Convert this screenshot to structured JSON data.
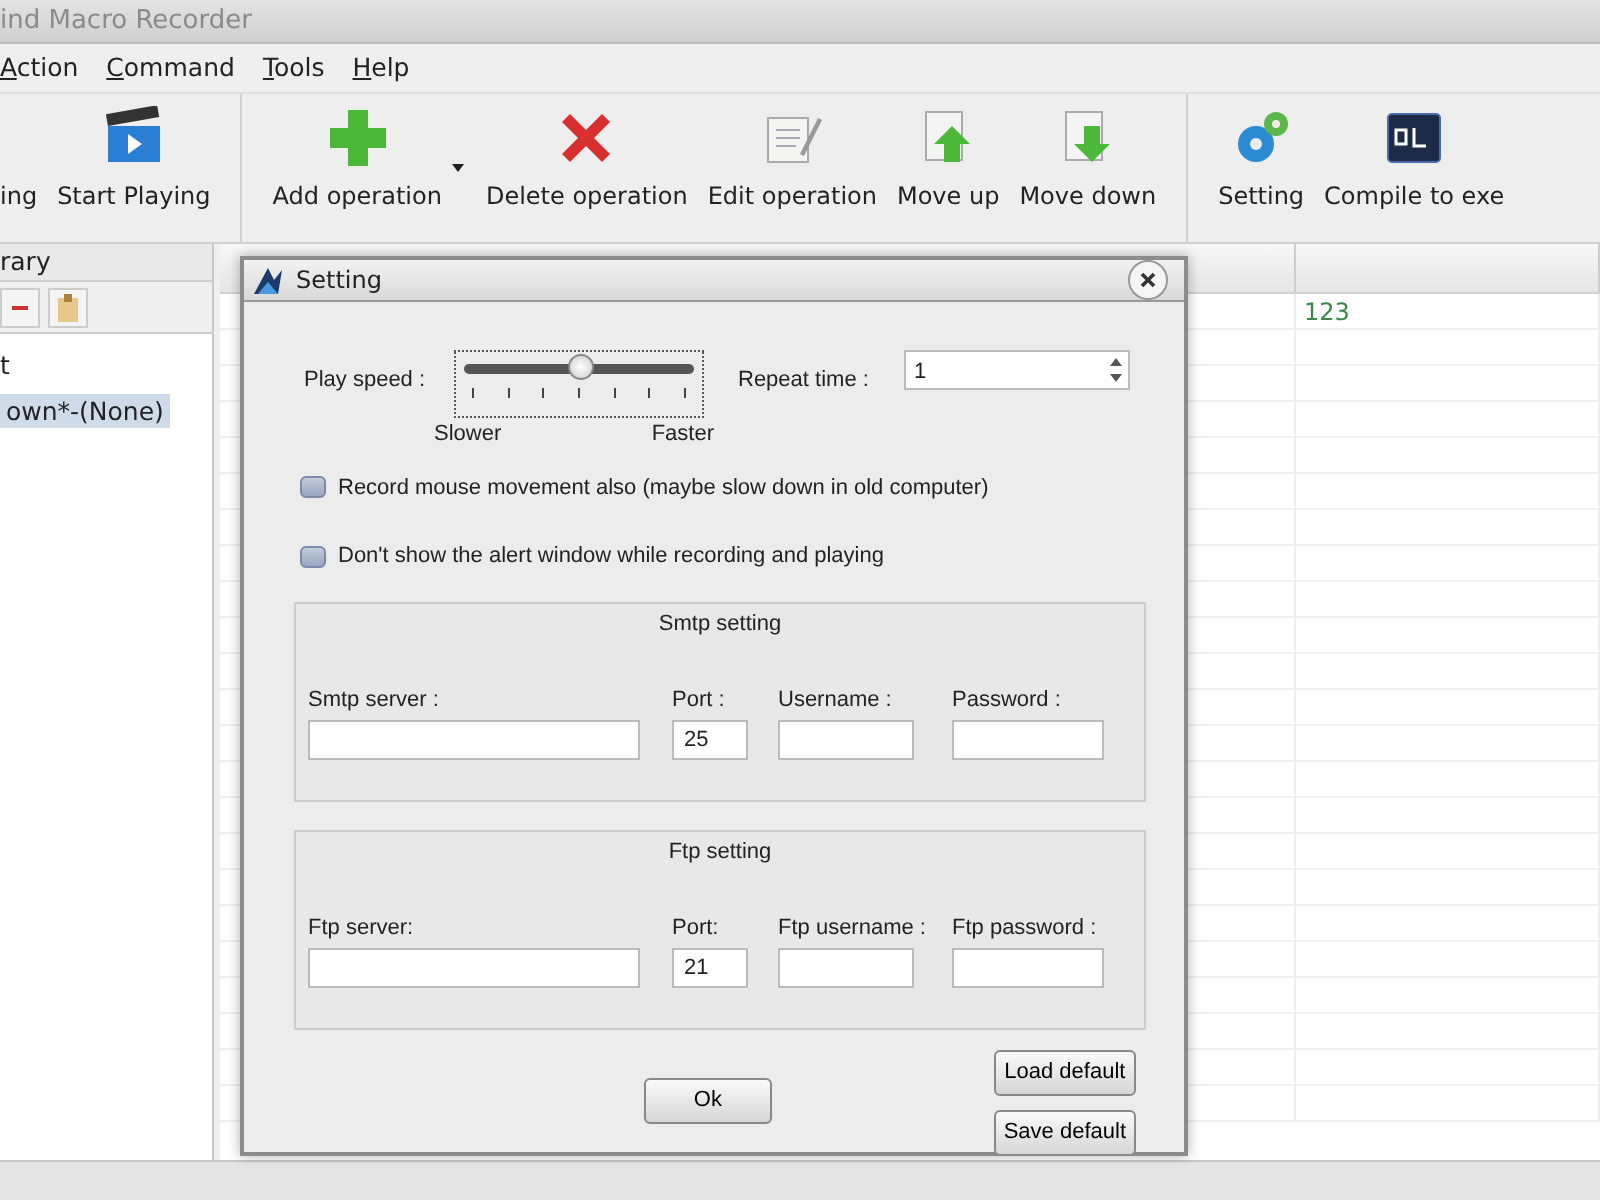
{
  "window": {
    "title": "ind Macro Recorder"
  },
  "menu": [
    {
      "label": "Action"
    },
    {
      "label": "Command"
    },
    {
      "label": "Tools"
    },
    {
      "label": "Help"
    }
  ],
  "toolbar": [
    {
      "label": "ing",
      "kind": "cut"
    },
    {
      "label": "Start Playing",
      "kind": "clapper"
    },
    {
      "kind": "separator"
    },
    {
      "label": "Add operation",
      "kind": "plus",
      "dropdown": true
    },
    {
      "label": "Delete operation",
      "kind": "cross"
    },
    {
      "label": "Edit operation",
      "kind": "notepad"
    },
    {
      "label": "Move up",
      "kind": "up"
    },
    {
      "label": "Move down",
      "kind": "down"
    },
    {
      "kind": "separator"
    },
    {
      "label": "Setting",
      "kind": "gears"
    },
    {
      "label": "Compile to exe",
      "kind": "console"
    }
  ],
  "library": {
    "title": "rary",
    "tools": [
      {
        "kind": "minus"
      },
      {
        "kind": "paste"
      }
    ],
    "items": [
      {
        "label": "t",
        "selected": false
      },
      {
        "label": "own*-(None)",
        "selected": true
      }
    ]
  },
  "table": {
    "rows": [
      {
        "column_2": "123"
      }
    ]
  },
  "dialog": {
    "title": "Setting",
    "play_speed": {
      "label": "Play speed :",
      "level": 0.5,
      "min_label": "Slower",
      "max_label": "Faster"
    },
    "repeat_time": {
      "label": "Repeat time :",
      "value": "1"
    },
    "checkboxes": [
      {
        "label": "Record mouse movement also (maybe slow down in old computer)",
        "checked": false
      },
      {
        "label": "Don't show the alert window while recording and playing",
        "checked": false
      }
    ],
    "groups": [
      {
        "title": "Smtp setting",
        "fields": [
          {
            "label": "Smtp server :"
          },
          {
            "label": "Port :",
            "value": "25"
          },
          {
            "label": "Username :"
          },
          {
            "label": "Password :"
          }
        ]
      },
      {
        "title": "Ftp setting",
        "fields": [
          {
            "label": "Ftp server:"
          },
          {
            "label": "Port:",
            "value": "21"
          },
          {
            "label": "Ftp username :"
          },
          {
            "label": "Ftp password :"
          }
        ]
      }
    ],
    "ok_button": "Ok",
    "side_buttons": [
      "Load default",
      "Save default"
    ]
  }
}
